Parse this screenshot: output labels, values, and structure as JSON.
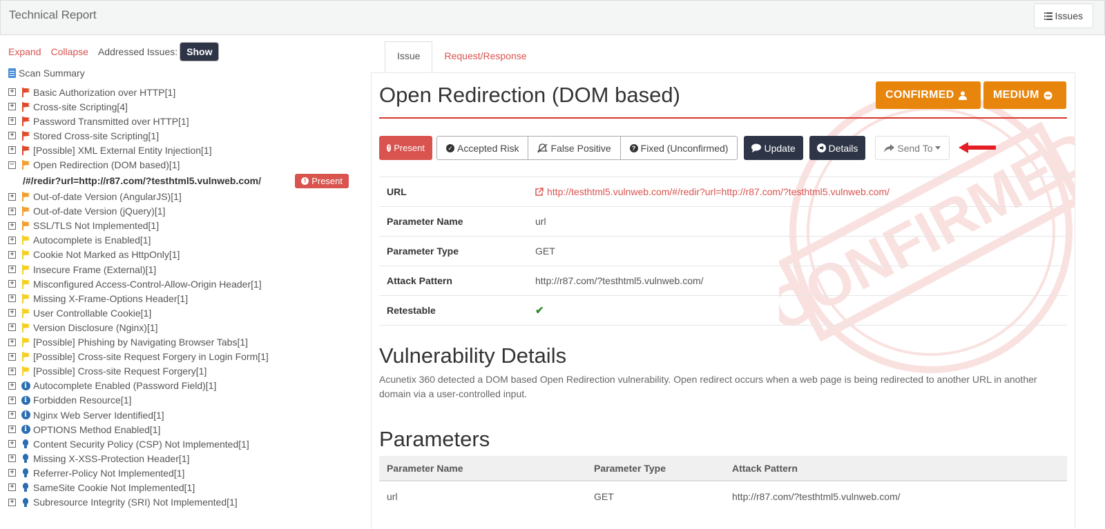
{
  "header": {
    "title": "Technical Report",
    "issues_label": "Issues"
  },
  "left": {
    "expand": "Expand",
    "collapse": "Collapse",
    "addressed_label": "Addressed Issues:",
    "show_label": "Show",
    "scan_summary": "Scan Summary",
    "tree": [
      {
        "label": "Basic Authorization over HTTP",
        "count": "[1]",
        "icon": "flag",
        "color": "#e04a2a",
        "expanded": false
      },
      {
        "label": "Cross-site Scripting",
        "count": "[4]",
        "icon": "flag",
        "color": "#e04a2a",
        "expanded": false
      },
      {
        "label": "Password Transmitted over HTTP",
        "count": "[1]",
        "icon": "flag",
        "color": "#e04a2a",
        "expanded": false
      },
      {
        "label": "Stored Cross-site Scripting",
        "count": "[1]",
        "icon": "flag",
        "color": "#e04a2a",
        "expanded": false
      },
      {
        "label": "[Possible] XML External Entity Injection",
        "count": "[1]",
        "icon": "flag",
        "color": "#e04a2a",
        "expanded": false
      },
      {
        "label": "Open Redirection (DOM based)",
        "count": "[1]",
        "icon": "flag",
        "color": "#f0a030",
        "expanded": true
      },
      {
        "label": "Out-of-date Version (AngularJS)",
        "count": "[1]",
        "icon": "flag",
        "color": "#f0a030",
        "expanded": false
      },
      {
        "label": "Out-of-date Version (jQuery)",
        "count": "[1]",
        "icon": "flag",
        "color": "#f0a030",
        "expanded": false
      },
      {
        "label": "SSL/TLS Not Implemented",
        "count": "[1]",
        "icon": "flag",
        "color": "#f0a030",
        "expanded": false
      },
      {
        "label": "Autocomplete is Enabled",
        "count": "[1]",
        "icon": "flag",
        "color": "#f5d020",
        "expanded": false
      },
      {
        "label": "Cookie Not Marked as HttpOnly",
        "count": "[1]",
        "icon": "flag",
        "color": "#f5d020",
        "expanded": false
      },
      {
        "label": "Insecure Frame (External)",
        "count": "[1]",
        "icon": "flag",
        "color": "#f5d020",
        "expanded": false
      },
      {
        "label": "Misconfigured Access-Control-Allow-Origin Header",
        "count": "[1]",
        "icon": "flag",
        "color": "#f5d020",
        "expanded": false
      },
      {
        "label": "Missing X-Frame-Options Header",
        "count": "[1]",
        "icon": "flag",
        "color": "#f5d020",
        "expanded": false
      },
      {
        "label": "User Controllable Cookie",
        "count": "[1]",
        "icon": "flag",
        "color": "#f5d020",
        "expanded": false
      },
      {
        "label": "Version Disclosure (Nginx)",
        "count": "[1]",
        "icon": "flag",
        "color": "#f5d020",
        "expanded": false
      },
      {
        "label": "[Possible] Phishing by Navigating Browser Tabs",
        "count": "[1]",
        "icon": "flag",
        "color": "#f5d020",
        "expanded": false
      },
      {
        "label": "[Possible] Cross-site Request Forgery in Login Form",
        "count": "[1]",
        "icon": "flag",
        "color": "#f5d020",
        "expanded": false
      },
      {
        "label": "[Possible] Cross-site Request Forgery",
        "count": "[1]",
        "icon": "flag",
        "color": "#f5d020",
        "expanded": false
      },
      {
        "label": "Autocomplete Enabled (Password Field)",
        "count": "[1]",
        "icon": "info",
        "color": "#2a6db0",
        "expanded": false
      },
      {
        "label": "Forbidden Resource",
        "count": "[1]",
        "icon": "info",
        "color": "#2a6db0",
        "expanded": false
      },
      {
        "label": "Nginx Web Server Identified",
        "count": "[1]",
        "icon": "info",
        "color": "#2a6db0",
        "expanded": false
      },
      {
        "label": "OPTIONS Method Enabled",
        "count": "[1]",
        "icon": "info",
        "color": "#2a6db0",
        "expanded": false
      },
      {
        "label": "Content Security Policy (CSP) Not Implemented",
        "count": "[1]",
        "icon": "bulb",
        "color": "#2a6db0",
        "expanded": false
      },
      {
        "label": "Missing X-XSS-Protection Header",
        "count": "[1]",
        "icon": "bulb",
        "color": "#2a6db0",
        "expanded": false
      },
      {
        "label": "Referrer-Policy Not Implemented",
        "count": "[1]",
        "icon": "bulb",
        "color": "#2a6db0",
        "expanded": false
      },
      {
        "label": "SameSite Cookie Not Implemented",
        "count": "[1]",
        "icon": "bulb",
        "color": "#2a6db0",
        "expanded": false
      },
      {
        "label": "Subresource Integrity (SRI) Not Implemented",
        "count": "[1]",
        "icon": "bulb",
        "color": "#2a6db0",
        "expanded": false
      }
    ],
    "sub_item": {
      "path": "/#/redir?url=http://r87.com/?testhtml5.vulnweb.com/",
      "status": "Present"
    }
  },
  "tabs": [
    {
      "label": "Issue"
    },
    {
      "label": "Request/Response"
    }
  ],
  "issue": {
    "title": "Open Redirection (DOM based)",
    "confirmed_label": "CONFIRMED",
    "severity_label": "MEDIUM",
    "stamp_text": "CONFIRMED",
    "actions": {
      "present": "Present",
      "accepted_risk": "Accepted Risk",
      "false_positive": "False Positive",
      "fixed_unconfirmed": "Fixed (Unconfirmed)",
      "update": "Update",
      "details": "Details",
      "send_to": "Send To"
    },
    "kv": [
      {
        "key": "URL",
        "value": "http://testhtml5.vulnweb.com/#/redir?url=http://r87.com/?testhtml5.vulnweb.com/"
      },
      {
        "key": "Parameter Name",
        "value": "url"
      },
      {
        "key": "Parameter Type",
        "value": "GET"
      },
      {
        "key": "Attack Pattern",
        "value": "http://r87.com/?testhtml5.vulnweb.com/"
      },
      {
        "key": "Retestable",
        "value": "✔"
      }
    ],
    "details_heading": "Vulnerability Details",
    "details_text": "Acunetix 360 detected a DOM based Open Redirection vulnerability. Open redirect occurs when a web page is being redirected to another URL in another domain via a user-controlled input.",
    "params_heading": "Parameters",
    "params_headers": [
      "Parameter Name",
      "Parameter Type",
      "Attack Pattern"
    ],
    "params_rows": [
      [
        "url",
        "GET",
        "http://r87.com/?testhtml5.vulnweb.com/"
      ]
    ]
  },
  "colors": {
    "accent_red": "#d9534f",
    "dark_button": "#2e3547",
    "badge_orange": "#e8850c",
    "rule_red": "#d9342b"
  }
}
